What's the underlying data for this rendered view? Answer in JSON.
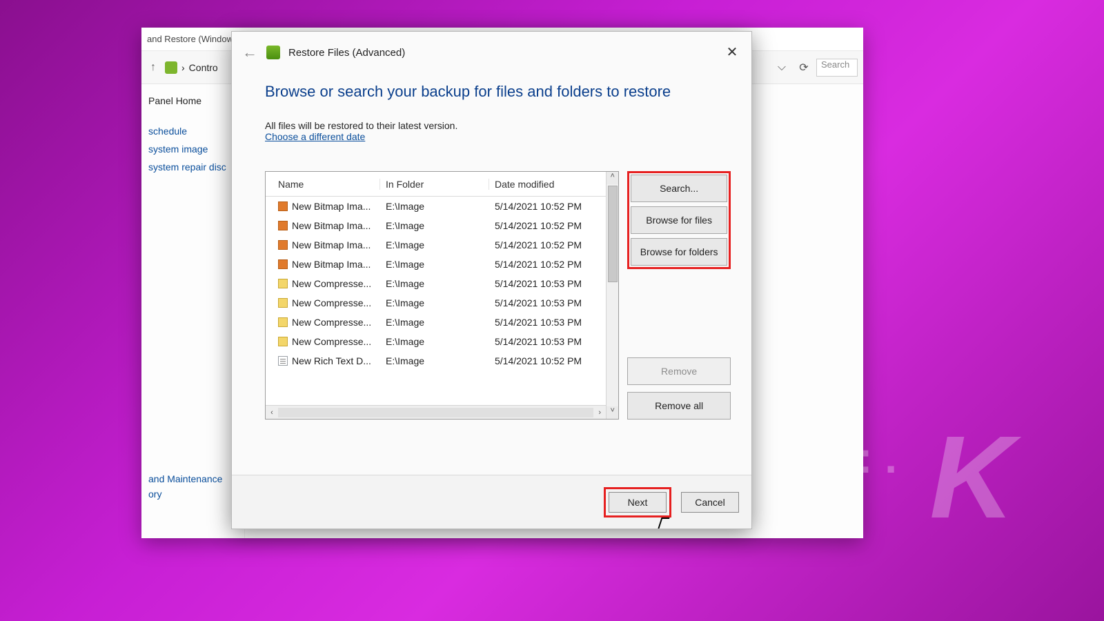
{
  "bg": {
    "title": "and Restore (Window",
    "breadcrumb": "Contro",
    "search_placeholder": "Search",
    "sidebar": {
      "home": "Panel Home",
      "links": [
        "schedule",
        "system image",
        "system repair disc"
      ],
      "footer1": "and Maintenance",
      "footer2": "ory"
    }
  },
  "wizard": {
    "title": "Restore Files (Advanced)",
    "heading": "Browse or search your backup for files and folders to restore",
    "subtext": "All files will be restored to their latest version.",
    "datelink": "Choose a different date",
    "columns": {
      "name": "Name",
      "folder": "In Folder",
      "date": "Date modified"
    },
    "rows": [
      {
        "icon": "bmp",
        "name": "New Bitmap Ima...",
        "folder": "E:\\Image",
        "date": "5/14/2021 10:52 PM"
      },
      {
        "icon": "bmp",
        "name": "New Bitmap Ima...",
        "folder": "E:\\Image",
        "date": "5/14/2021 10:52 PM"
      },
      {
        "icon": "bmp",
        "name": "New Bitmap Ima...",
        "folder": "E:\\Image",
        "date": "5/14/2021 10:52 PM"
      },
      {
        "icon": "bmp",
        "name": "New Bitmap Ima...",
        "folder": "E:\\Image",
        "date": "5/14/2021 10:52 PM"
      },
      {
        "icon": "zip",
        "name": "New Compresse...",
        "folder": "E:\\Image",
        "date": "5/14/2021 10:53 PM"
      },
      {
        "icon": "zip",
        "name": "New Compresse...",
        "folder": "E:\\Image",
        "date": "5/14/2021 10:53 PM"
      },
      {
        "icon": "zip",
        "name": "New Compresse...",
        "folder": "E:\\Image",
        "date": "5/14/2021 10:53 PM"
      },
      {
        "icon": "zip",
        "name": "New Compresse...",
        "folder": "E:\\Image",
        "date": "5/14/2021 10:53 PM"
      },
      {
        "icon": "rtf",
        "name": "New Rich Text D...",
        "folder": "E:\\Image",
        "date": "5/14/2021 10:52 PM"
      }
    ],
    "buttons": {
      "search": "Search...",
      "browse_files": "Browse for files",
      "browse_folders": "Browse for folders",
      "remove": "Remove",
      "remove_all": "Remove all",
      "next": "Next",
      "cancel": "Cancel"
    }
  }
}
